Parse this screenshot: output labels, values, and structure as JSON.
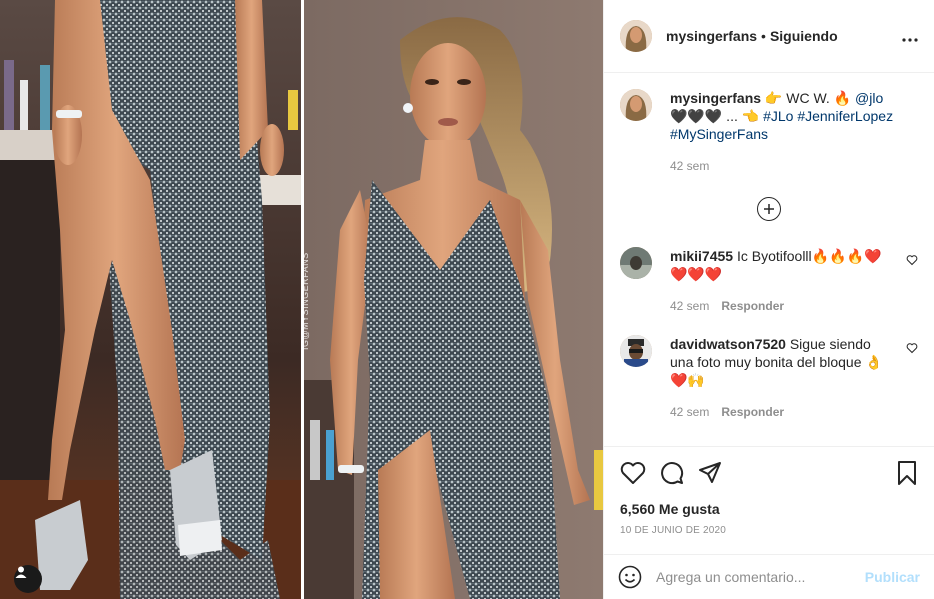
{
  "media": {
    "watermark": "IG@MYSINGERFANS",
    "tag_icon": "user-tag-icon"
  },
  "header": {
    "username": "mysingerfans",
    "dot": "•",
    "follow_state": "Siguiendo",
    "more_icon": "more-options-icon"
  },
  "caption": {
    "username": "mysingerfans",
    "text_parts": [
      {
        "kind": "text",
        "value": " 👉 WC W. 🔥 "
      },
      {
        "kind": "tag",
        "value": "@jlo"
      },
      {
        "kind": "text",
        "value": " 🖤🖤🖤 ... 👈 "
      },
      {
        "kind": "tag",
        "value": "#JLo"
      },
      {
        "kind": "text",
        "value": " "
      },
      {
        "kind": "tag",
        "value": "#JenniferLopez"
      },
      {
        "kind": "text",
        "value": " "
      },
      {
        "kind": "tag",
        "value": "#MySingerFans"
      }
    ],
    "time": "42 sem"
  },
  "load_more_icon": "plus-circle-icon",
  "comments": [
    {
      "username": "mikii7455",
      "text": "Ic Byotifoolll🔥🔥🔥❤️❤️❤️❤️",
      "time": "42 sem",
      "reply_label": "Responder"
    },
    {
      "username": "davidwatson7520",
      "text": "Sigue siendo una foto muy bonita del bloque 👌❤️🙌",
      "time": "42 sem",
      "reply_label": "Responder"
    }
  ],
  "actions": {
    "like_icon": "heart-icon",
    "comment_icon": "comment-icon",
    "share_icon": "share-icon",
    "save_icon": "bookmark-icon"
  },
  "likes": "6,560 Me gusta",
  "date": "10 DE JUNIO DE 2020",
  "add_comment": {
    "placeholder": "Agrega un comentario...",
    "post_label": "Publicar",
    "emoji_icon": "emoji-icon"
  },
  "colors": {
    "link": "#00376b",
    "muted": "#8e8e8e",
    "publish_disabled": "#b2dffc",
    "text": "#262626"
  }
}
